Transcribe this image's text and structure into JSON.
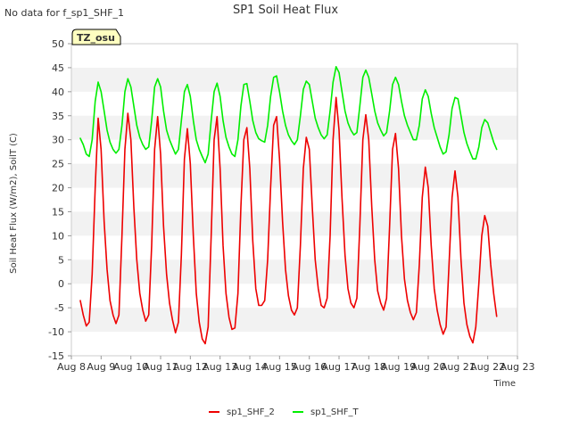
{
  "no_data_text": "No data for f_sp1_SHF_1",
  "badge_text": "TZ_osu",
  "chart_data": {
    "type": "line",
    "title": "SP1 Soil Heat Flux",
    "xlabel": "Time",
    "ylabel": "Soil Heat Flux (W/m2), SoilT (C)",
    "xlim": [
      8,
      23
    ],
    "ylim": [
      -15,
      50
    ],
    "x_tick_values": [
      8,
      9,
      10,
      11,
      12,
      13,
      14,
      15,
      16,
      17,
      18,
      19,
      20,
      21,
      22,
      23
    ],
    "x_tick_labels": [
      "Aug 8",
      "Aug 9",
      "Aug 10",
      "Aug 11",
      "Aug 12",
      "Aug 13",
      "Aug 14",
      "Aug 15",
      "Aug 16",
      "Aug 17",
      "Aug 18",
      "Aug 19",
      "Aug 20",
      "Aug 21",
      "Aug 22",
      "Aug 23"
    ],
    "y_ticks": [
      -15,
      -10,
      -5,
      0,
      5,
      10,
      15,
      20,
      25,
      30,
      35,
      40,
      45,
      50
    ],
    "grid": "alternating horizontal bands",
    "legend_position": "bottom-center",
    "series": [
      {
        "name": "sp1_SHF_2",
        "color": "#ee0000",
        "points": [
          [
            8.3,
            -3.5
          ],
          [
            8.4,
            -6.5
          ],
          [
            8.5,
            -8.8
          ],
          [
            8.6,
            -8
          ],
          [
            8.7,
            2
          ],
          [
            8.8,
            20
          ],
          [
            8.9,
            34.5
          ],
          [
            9.0,
            28
          ],
          [
            9.1,
            13
          ],
          [
            9.2,
            3
          ],
          [
            9.3,
            -3.5
          ],
          [
            9.4,
            -6.5
          ],
          [
            9.5,
            -8.3
          ],
          [
            9.6,
            -6.5
          ],
          [
            9.7,
            10
          ],
          [
            9.8,
            28
          ],
          [
            9.9,
            35.5
          ],
          [
            10.0,
            30
          ],
          [
            10.1,
            16
          ],
          [
            10.2,
            5
          ],
          [
            10.3,
            -2
          ],
          [
            10.4,
            -5.5
          ],
          [
            10.5,
            -7.8
          ],
          [
            10.6,
            -6.5
          ],
          [
            10.7,
            8
          ],
          [
            10.8,
            28
          ],
          [
            10.9,
            34.8
          ],
          [
            11.0,
            27
          ],
          [
            11.1,
            12
          ],
          [
            11.2,
            2
          ],
          [
            11.3,
            -4
          ],
          [
            11.4,
            -7.5
          ],
          [
            11.5,
            -10.2
          ],
          [
            11.6,
            -8
          ],
          [
            11.7,
            6
          ],
          [
            11.8,
            26
          ],
          [
            11.9,
            32.3
          ],
          [
            12.0,
            25
          ],
          [
            12.1,
            10
          ],
          [
            12.2,
            -2
          ],
          [
            12.3,
            -8
          ],
          [
            12.4,
            -11.5
          ],
          [
            12.5,
            -12.5
          ],
          [
            12.6,
            -9
          ],
          [
            12.7,
            10
          ],
          [
            12.8,
            30
          ],
          [
            12.9,
            34.8
          ],
          [
            13.0,
            24
          ],
          [
            13.1,
            8
          ],
          [
            13.2,
            -2
          ],
          [
            13.3,
            -7
          ],
          [
            13.4,
            -9.5
          ],
          [
            13.5,
            -9.2
          ],
          [
            13.6,
            -2
          ],
          [
            13.7,
            16
          ],
          [
            13.8,
            30
          ],
          [
            13.9,
            32.5
          ],
          [
            14.0,
            24
          ],
          [
            14.1,
            9
          ],
          [
            14.2,
            -1
          ],
          [
            14.3,
            -4.5
          ],
          [
            14.4,
            -4.5
          ],
          [
            14.5,
            -3.5
          ],
          [
            14.6,
            5
          ],
          [
            14.7,
            20
          ],
          [
            14.8,
            33
          ],
          [
            14.9,
            34.8
          ],
          [
            15.0,
            26
          ],
          [
            15.1,
            13
          ],
          [
            15.2,
            3
          ],
          [
            15.3,
            -2.5
          ],
          [
            15.4,
            -5.5
          ],
          [
            15.5,
            -6.5
          ],
          [
            15.6,
            -5
          ],
          [
            15.7,
            8
          ],
          [
            15.8,
            24
          ],
          [
            15.9,
            30.5
          ],
          [
            16.0,
            28
          ],
          [
            16.1,
            16
          ],
          [
            16.2,
            5
          ],
          [
            16.3,
            -1
          ],
          [
            16.4,
            -4.5
          ],
          [
            16.5,
            -5
          ],
          [
            16.6,
            -3
          ],
          [
            16.7,
            10
          ],
          [
            16.8,
            30
          ],
          [
            16.9,
            38.8
          ],
          [
            17.0,
            32
          ],
          [
            17.1,
            18
          ],
          [
            17.2,
            6
          ],
          [
            17.3,
            -1
          ],
          [
            17.4,
            -4
          ],
          [
            17.5,
            -5
          ],
          [
            17.6,
            -3
          ],
          [
            17.7,
            12
          ],
          [
            17.8,
            30
          ],
          [
            17.9,
            35.2
          ],
          [
            18.0,
            30
          ],
          [
            18.1,
            16
          ],
          [
            18.2,
            5
          ],
          [
            18.3,
            -1.5
          ],
          [
            18.4,
            -4
          ],
          [
            18.5,
            -5.5
          ],
          [
            18.6,
            -3
          ],
          [
            18.7,
            12
          ],
          [
            18.8,
            28
          ],
          [
            18.9,
            31.3
          ],
          [
            19.0,
            24
          ],
          [
            19.1,
            10
          ],
          [
            19.2,
            1
          ],
          [
            19.3,
            -3.5
          ],
          [
            19.4,
            -6
          ],
          [
            19.5,
            -7.5
          ],
          [
            19.6,
            -6
          ],
          [
            19.7,
            4
          ],
          [
            19.8,
            18
          ],
          [
            19.9,
            24.3
          ],
          [
            20.0,
            20
          ],
          [
            20.1,
            8
          ],
          [
            20.2,
            -1
          ],
          [
            20.3,
            -5.5
          ],
          [
            20.4,
            -8.5
          ],
          [
            20.5,
            -10.5
          ],
          [
            20.6,
            -9
          ],
          [
            20.7,
            4
          ],
          [
            20.8,
            18
          ],
          [
            20.9,
            23.5
          ],
          [
            21.0,
            18
          ],
          [
            21.1,
            5
          ],
          [
            21.2,
            -4
          ],
          [
            21.3,
            -8.5
          ],
          [
            21.4,
            -11
          ],
          [
            21.5,
            -12.3
          ],
          [
            21.6,
            -9
          ],
          [
            21.7,
            0
          ],
          [
            21.8,
            10
          ],
          [
            21.9,
            14.2
          ],
          [
            22.0,
            12
          ],
          [
            22.1,
            4
          ],
          [
            22.2,
            -2
          ],
          [
            22.3,
            -6.8
          ]
        ]
      },
      {
        "name": "sp1_SHF_T",
        "color": "#00ee00",
        "points": [
          [
            8.3,
            30.3
          ],
          [
            8.4,
            29
          ],
          [
            8.5,
            27
          ],
          [
            8.6,
            26.5
          ],
          [
            8.7,
            30
          ],
          [
            8.8,
            38
          ],
          [
            8.9,
            42
          ],
          [
            9.0,
            40
          ],
          [
            9.1,
            36
          ],
          [
            9.2,
            32
          ],
          [
            9.3,
            29.5
          ],
          [
            9.4,
            28
          ],
          [
            9.5,
            27.2
          ],
          [
            9.6,
            28
          ],
          [
            9.7,
            33
          ],
          [
            9.8,
            40
          ],
          [
            9.9,
            42.7
          ],
          [
            10.0,
            41
          ],
          [
            10.1,
            37
          ],
          [
            10.2,
            33
          ],
          [
            10.3,
            30.5
          ],
          [
            10.4,
            29
          ],
          [
            10.5,
            28
          ],
          [
            10.6,
            28.5
          ],
          [
            10.7,
            34
          ],
          [
            10.8,
            41
          ],
          [
            10.9,
            42.7
          ],
          [
            11.0,
            41
          ],
          [
            11.1,
            36
          ],
          [
            11.2,
            32
          ],
          [
            11.3,
            30
          ],
          [
            11.4,
            28.5
          ],
          [
            11.5,
            27
          ],
          [
            11.6,
            28
          ],
          [
            11.7,
            34
          ],
          [
            11.8,
            40
          ],
          [
            11.9,
            41.5
          ],
          [
            12.0,
            39
          ],
          [
            12.1,
            34
          ],
          [
            12.2,
            30
          ],
          [
            12.3,
            28
          ],
          [
            12.4,
            26.5
          ],
          [
            12.5,
            25.2
          ],
          [
            12.6,
            27
          ],
          [
            12.7,
            34
          ],
          [
            12.8,
            40
          ],
          [
            12.9,
            41.8
          ],
          [
            13.0,
            39
          ],
          [
            13.1,
            34
          ],
          [
            13.2,
            30.5
          ],
          [
            13.3,
            28.5
          ],
          [
            13.4,
            27
          ],
          [
            13.5,
            26.5
          ],
          [
            13.6,
            30
          ],
          [
            13.7,
            37
          ],
          [
            13.8,
            41.5
          ],
          [
            13.9,
            41.7
          ],
          [
            14.0,
            38
          ],
          [
            14.1,
            34
          ],
          [
            14.2,
            31.5
          ],
          [
            14.3,
            30.2
          ],
          [
            14.4,
            29.8
          ],
          [
            14.5,
            29.5
          ],
          [
            14.6,
            33
          ],
          [
            14.7,
            39
          ],
          [
            14.8,
            43
          ],
          [
            14.9,
            43.3
          ],
          [
            15.0,
            40
          ],
          [
            15.1,
            36
          ],
          [
            15.2,
            33
          ],
          [
            15.3,
            31
          ],
          [
            15.4,
            29.8
          ],
          [
            15.5,
            29
          ],
          [
            15.6,
            30
          ],
          [
            15.7,
            35
          ],
          [
            15.8,
            40.5
          ],
          [
            15.9,
            42.2
          ],
          [
            16.0,
            41.5
          ],
          [
            16.1,
            38
          ],
          [
            16.2,
            34.5
          ],
          [
            16.3,
            32.5
          ],
          [
            16.4,
            31
          ],
          [
            16.5,
            30.2
          ],
          [
            16.6,
            31
          ],
          [
            16.7,
            36
          ],
          [
            16.8,
            42
          ],
          [
            16.9,
            45.2
          ],
          [
            17.0,
            44
          ],
          [
            17.1,
            40
          ],
          [
            17.2,
            36
          ],
          [
            17.3,
            33.5
          ],
          [
            17.4,
            32
          ],
          [
            17.5,
            31
          ],
          [
            17.6,
            31.5
          ],
          [
            17.7,
            37
          ],
          [
            17.8,
            43
          ],
          [
            17.9,
            44.5
          ],
          [
            18.0,
            43
          ],
          [
            18.1,
            39.5
          ],
          [
            18.2,
            36
          ],
          [
            18.3,
            33.5
          ],
          [
            18.4,
            32
          ],
          [
            18.5,
            30.8
          ],
          [
            18.6,
            31.5
          ],
          [
            18.7,
            36
          ],
          [
            18.8,
            41.5
          ],
          [
            18.9,
            43
          ],
          [
            19.0,
            41.5
          ],
          [
            19.1,
            38
          ],
          [
            19.2,
            35
          ],
          [
            19.3,
            33
          ],
          [
            19.4,
            31.5
          ],
          [
            19.5,
            30
          ],
          [
            19.6,
            30
          ],
          [
            19.7,
            33
          ],
          [
            19.8,
            38.5
          ],
          [
            19.9,
            40.4
          ],
          [
            20.0,
            39
          ],
          [
            20.1,
            35.5
          ],
          [
            20.2,
            32.5
          ],
          [
            20.3,
            30.5
          ],
          [
            20.4,
            28.5
          ],
          [
            20.5,
            27
          ],
          [
            20.6,
            27.5
          ],
          [
            20.7,
            31
          ],
          [
            20.8,
            36.5
          ],
          [
            20.9,
            38.8
          ],
          [
            21.0,
            38.5
          ],
          [
            21.1,
            35
          ],
          [
            21.2,
            31.5
          ],
          [
            21.3,
            29.2
          ],
          [
            21.4,
            27.5
          ],
          [
            21.5,
            26
          ],
          [
            21.6,
            26
          ],
          [
            21.7,
            28.5
          ],
          [
            21.8,
            32.5
          ],
          [
            21.9,
            34.2
          ],
          [
            22.0,
            33.5
          ],
          [
            22.1,
            31.5
          ],
          [
            22.2,
            29.5
          ],
          [
            22.3,
            28
          ]
        ]
      }
    ]
  }
}
